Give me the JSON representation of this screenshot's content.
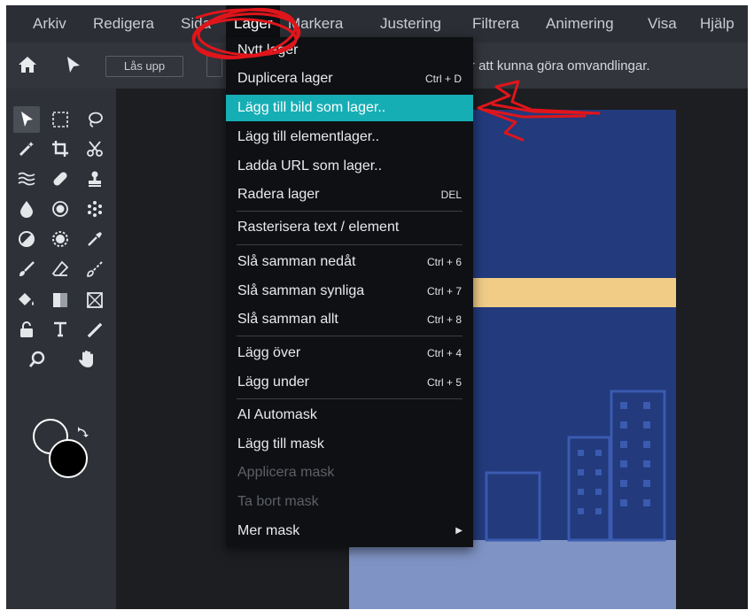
{
  "menubar": {
    "items": [
      "Arkiv",
      "Redigera",
      "Sida",
      "Lager",
      "Markera",
      "Justering",
      "Filtrera",
      "Animering",
      "Visa",
      "Hjälp"
    ]
  },
  "options": {
    "unlock_label": "Lås upp",
    "message": "Lagret är låst, lås upp för att kunna göra omvandlingar."
  },
  "dropdown": {
    "items": [
      {
        "label": "Nytt lager",
        "shortcut": ""
      },
      {
        "label": "Duplicera lager",
        "shortcut": "Ctrl + D"
      },
      {
        "label": "Lägg till bild som lager..",
        "shortcut": ""
      },
      {
        "label": "Lägg till elementlager..",
        "shortcut": ""
      },
      {
        "label": "Ladda URL som lager..",
        "shortcut": ""
      },
      {
        "label": "Radera lager",
        "shortcut": "DEL"
      },
      {
        "label": "Rasterisera text / element",
        "shortcut": ""
      },
      {
        "label": "Slå samman nedåt",
        "shortcut": "Ctrl + 6"
      },
      {
        "label": "Slå samman synliga",
        "shortcut": "Ctrl + 7"
      },
      {
        "label": "Slå samman allt",
        "shortcut": "Ctrl + 8"
      },
      {
        "label": "Lägg över",
        "shortcut": "Ctrl + 4"
      },
      {
        "label": "Lägg under",
        "shortcut": "Ctrl + 5"
      },
      {
        "label": "AI Automask",
        "shortcut": ""
      },
      {
        "label": "Lägg till mask",
        "shortcut": ""
      },
      {
        "label": "Applicera mask",
        "shortcut": ""
      },
      {
        "label": "Ta bort mask",
        "shortcut": ""
      },
      {
        "label": "Mer mask",
        "shortcut": ""
      }
    ],
    "highlighted": "Lägg till bild som lager..",
    "disabled": [
      "Applicera mask",
      "Ta bort mask"
    ]
  },
  "colors": {
    "highlight": "#16aeb5",
    "annotation": "#e0151b",
    "canvas_blue": "#233a7c",
    "canvas_stripe": "#f0cc87",
    "canvas_ground": "#7f93c4"
  }
}
